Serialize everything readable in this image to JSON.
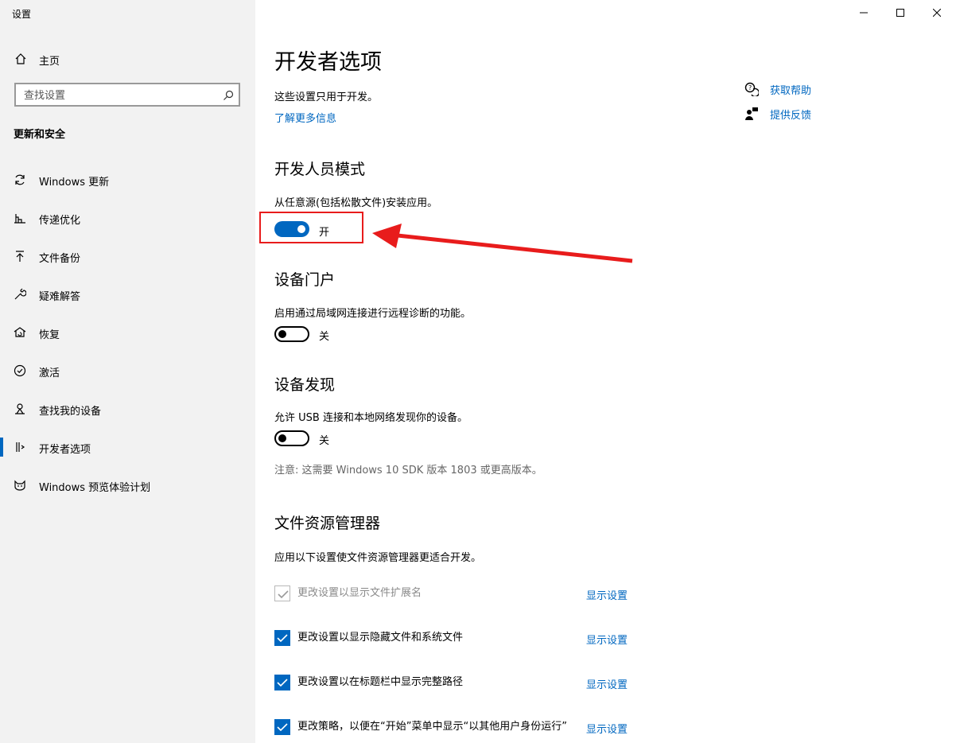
{
  "window": {
    "title": "设置",
    "controls": [
      "minimize",
      "maximize",
      "close"
    ]
  },
  "sidebar": {
    "home_label": "主页",
    "search_placeholder": "查找设置",
    "section_title": "更新和安全",
    "items": [
      {
        "label": "Windows 更新",
        "icon": "sync-icon"
      },
      {
        "label": "传递优化",
        "icon": "delivery-optimization-icon"
      },
      {
        "label": "文件备份",
        "icon": "backup-icon"
      },
      {
        "label": "疑难解答",
        "icon": "wrench-icon"
      },
      {
        "label": "恢复",
        "icon": "recovery-icon"
      },
      {
        "label": "激活",
        "icon": "activation-check-icon"
      },
      {
        "label": "查找我的设备",
        "icon": "find-device-icon"
      },
      {
        "label": "开发者选项",
        "icon": "developer-icon",
        "active": true
      },
      {
        "label": "Windows 预览体验计划",
        "icon": "insider-cat-icon"
      }
    ]
  },
  "main": {
    "title": "开发者选项",
    "intro": "这些设置只用于开发。",
    "learn_more": "了解更多信息",
    "help": {
      "get_help": "获取帮助",
      "feedback": "提供反馈"
    },
    "developer_mode": {
      "heading": "开发人员模式",
      "description": "从任意源(包括松散文件)安装应用。",
      "state_label": "开",
      "on": true
    },
    "device_portal": {
      "heading": "设备门户",
      "description": "启用通过局域网连接进行远程诊断的功能。",
      "state_label": "关",
      "on": false
    },
    "device_discovery": {
      "heading": "设备发现",
      "description": "允许 USB 连接和本地网络发现你的设备。",
      "state_label": "关",
      "on": false,
      "note": "注意: 这需要 Windows 10 SDK 版本 1803 或更高版本。"
    },
    "file_explorer": {
      "heading": "文件资源管理器",
      "description": "应用以下设置使文件资源管理器更适合开发。",
      "show_settings_label": "显示设置",
      "options": [
        {
          "label": "更改设置以显示文件扩展名",
          "checked": true,
          "disabled": true
        },
        {
          "label": "更改设置以显示隐藏文件和系统文件",
          "checked": true,
          "disabled": false
        },
        {
          "label": "更改设置以在标题栏中显示完整路径",
          "checked": true,
          "disabled": false
        },
        {
          "label": "更改策略，以便在“开始”菜单中显示“以其他用户身份运行”",
          "checked": true,
          "disabled": false
        }
      ]
    }
  },
  "colors": {
    "accent": "#0067c0",
    "sidebar_bg": "#f2f2f2",
    "annotation_red": "#e81c1c"
  }
}
